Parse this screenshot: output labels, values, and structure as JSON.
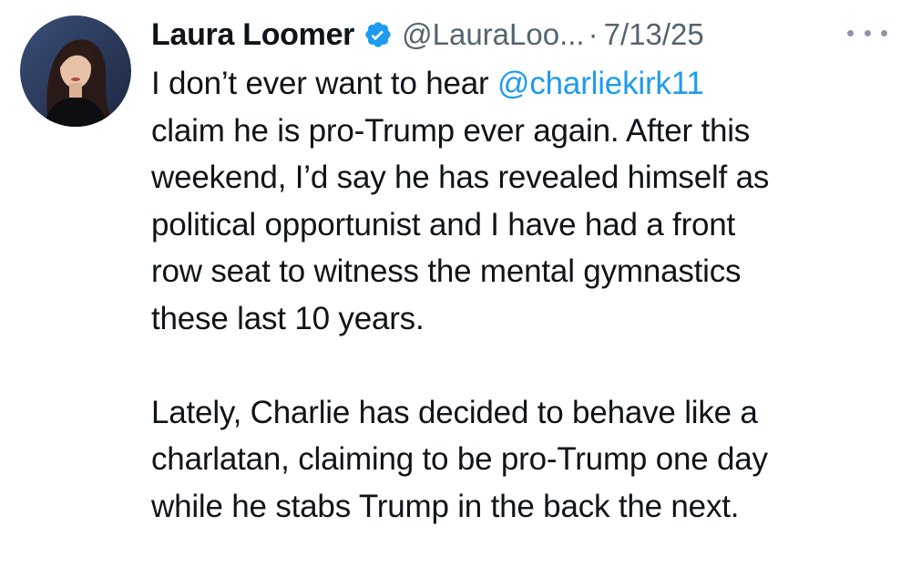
{
  "author": {
    "name": "Laura Loomer",
    "handle": "@LauraLoo...",
    "separator": "·",
    "date": "7/13/25",
    "verified_icon": "verified-badge-icon",
    "avatar_icon": "profile-photo"
  },
  "tweet": {
    "line1_prefix": "I don’t ever want to hear ",
    "mention": "@charliekirk11",
    "lines": [
      "claim he is pro-Trump ever again. After this",
      "weekend, I’d say he has revealed himself as",
      "political opportunist and I have had a front",
      "row seat to witness the mental gymnastics",
      "these last 10 years."
    ],
    "paragraph2": [
      "Lately, Charlie has decided to behave like a",
      "charlatan, claiming to be pro-Trump one day",
      "while he stabs Trump in the back the next."
    ]
  },
  "colors": {
    "text": "#0f1419",
    "secondary": "#536471",
    "accent": "#1d9bf0"
  },
  "more_icon": "more-options-icon"
}
